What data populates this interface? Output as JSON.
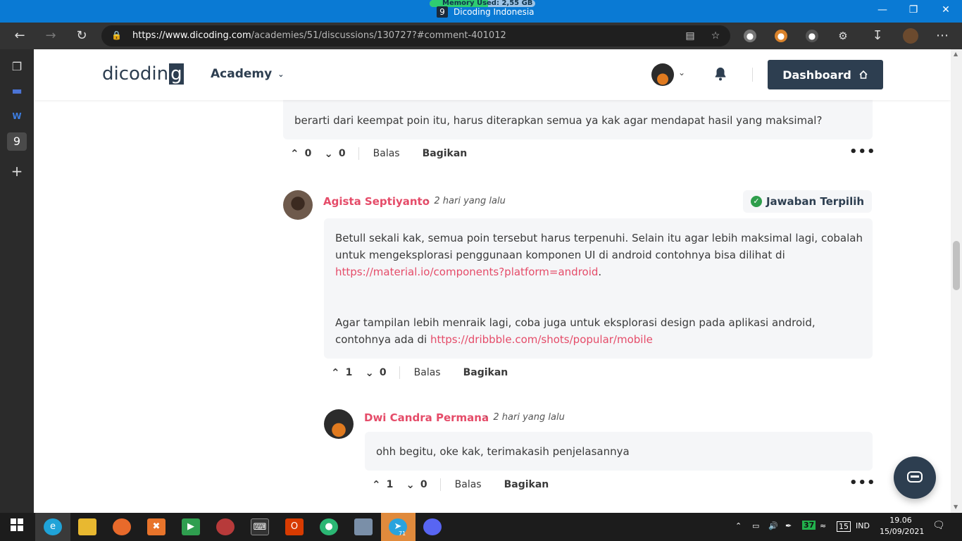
{
  "window": {
    "memory_label": "Memory Used: 2,55 GB",
    "memory_fraction": 0.55,
    "title": "Dicoding Indonesia",
    "favicon": "9"
  },
  "browser": {
    "url_domain": "https://www.dicoding.com",
    "url_path": "/academies/51/discussions/130727?#comment-401012"
  },
  "header": {
    "logo_text": "dicodin",
    "logo_last": "g",
    "academy_label": "Academy",
    "dashboard_label": "Dashboard"
  },
  "comments": {
    "c1": {
      "text": "berarti dari keempat poin itu, harus diterapkan semua ya kak agar mendapat hasil yang maksimal?",
      "upvotes": "0",
      "downvotes": "0",
      "reply_label": "Balas",
      "share_label": "Bagikan"
    },
    "c2": {
      "author": "Agista Septiyanto",
      "time": "2 hari yang lalu",
      "badge": "Jawaban Terpilih",
      "p1": "Betull sekali kak, semua poin tersebut harus terpenuhi. Selain itu agar lebih maksimal lagi, cobalah untuk mengeksplorasi penggunaan komponen UI di android contohnya bisa dilihat di",
      "link1": "https://material.io/components?platform=android",
      "p2": "Agar tampilan lebih menraik lagi, coba juga untuk eksplorasi design pada aplikasi android, contohnya ada di",
      "link2": "https://dribbble.com/shots/popular/mobile",
      "upvotes": "1",
      "downvotes": "0",
      "reply_label": "Balas",
      "share_label": "Bagikan"
    },
    "c3": {
      "author": "Dwi Candra Permana",
      "time": "2 hari yang lalu",
      "text": "ohh begitu, oke kak, terimakasih penjelasannya",
      "upvotes": "1",
      "downvotes": "0",
      "reply_label": "Balas",
      "share_label": "Bagikan"
    }
  },
  "taskbar": {
    "telegram_badge": "71",
    "battery_badge": "37",
    "notif_badge": "15",
    "language": "IND",
    "time": "19.06",
    "date": "15/09/2021"
  },
  "colors": {
    "accent": "#e54c69",
    "brand": "#2d3e50",
    "titlebar": "#0a7ad4",
    "success": "#2e9e4b"
  }
}
